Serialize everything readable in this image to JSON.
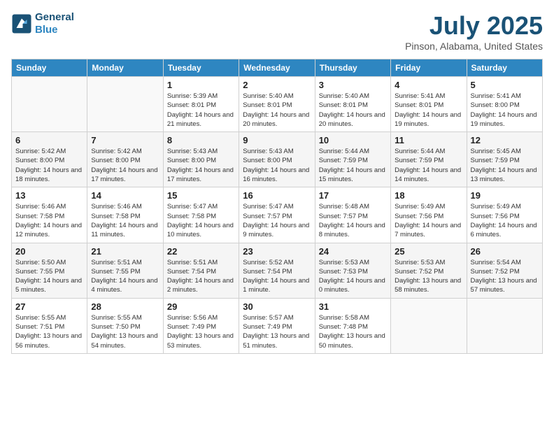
{
  "header": {
    "logo_line1": "General",
    "logo_line2": "Blue",
    "month": "July 2025",
    "location": "Pinson, Alabama, United States"
  },
  "weekdays": [
    "Sunday",
    "Monday",
    "Tuesday",
    "Wednesday",
    "Thursday",
    "Friday",
    "Saturday"
  ],
  "weeks": [
    [
      {
        "day": "",
        "info": ""
      },
      {
        "day": "",
        "info": ""
      },
      {
        "day": "1",
        "info": "Sunrise: 5:39 AM\nSunset: 8:01 PM\nDaylight: 14 hours and 21 minutes."
      },
      {
        "day": "2",
        "info": "Sunrise: 5:40 AM\nSunset: 8:01 PM\nDaylight: 14 hours and 20 minutes."
      },
      {
        "day": "3",
        "info": "Sunrise: 5:40 AM\nSunset: 8:01 PM\nDaylight: 14 hours and 20 minutes."
      },
      {
        "day": "4",
        "info": "Sunrise: 5:41 AM\nSunset: 8:01 PM\nDaylight: 14 hours and 19 minutes."
      },
      {
        "day": "5",
        "info": "Sunrise: 5:41 AM\nSunset: 8:00 PM\nDaylight: 14 hours and 19 minutes."
      }
    ],
    [
      {
        "day": "6",
        "info": "Sunrise: 5:42 AM\nSunset: 8:00 PM\nDaylight: 14 hours and 18 minutes."
      },
      {
        "day": "7",
        "info": "Sunrise: 5:42 AM\nSunset: 8:00 PM\nDaylight: 14 hours and 17 minutes."
      },
      {
        "day": "8",
        "info": "Sunrise: 5:43 AM\nSunset: 8:00 PM\nDaylight: 14 hours and 17 minutes."
      },
      {
        "day": "9",
        "info": "Sunrise: 5:43 AM\nSunset: 8:00 PM\nDaylight: 14 hours and 16 minutes."
      },
      {
        "day": "10",
        "info": "Sunrise: 5:44 AM\nSunset: 7:59 PM\nDaylight: 14 hours and 15 minutes."
      },
      {
        "day": "11",
        "info": "Sunrise: 5:44 AM\nSunset: 7:59 PM\nDaylight: 14 hours and 14 minutes."
      },
      {
        "day": "12",
        "info": "Sunrise: 5:45 AM\nSunset: 7:59 PM\nDaylight: 14 hours and 13 minutes."
      }
    ],
    [
      {
        "day": "13",
        "info": "Sunrise: 5:46 AM\nSunset: 7:58 PM\nDaylight: 14 hours and 12 minutes."
      },
      {
        "day": "14",
        "info": "Sunrise: 5:46 AM\nSunset: 7:58 PM\nDaylight: 14 hours and 11 minutes."
      },
      {
        "day": "15",
        "info": "Sunrise: 5:47 AM\nSunset: 7:58 PM\nDaylight: 14 hours and 10 minutes."
      },
      {
        "day": "16",
        "info": "Sunrise: 5:47 AM\nSunset: 7:57 PM\nDaylight: 14 hours and 9 minutes."
      },
      {
        "day": "17",
        "info": "Sunrise: 5:48 AM\nSunset: 7:57 PM\nDaylight: 14 hours and 8 minutes."
      },
      {
        "day": "18",
        "info": "Sunrise: 5:49 AM\nSunset: 7:56 PM\nDaylight: 14 hours and 7 minutes."
      },
      {
        "day": "19",
        "info": "Sunrise: 5:49 AM\nSunset: 7:56 PM\nDaylight: 14 hours and 6 minutes."
      }
    ],
    [
      {
        "day": "20",
        "info": "Sunrise: 5:50 AM\nSunset: 7:55 PM\nDaylight: 14 hours and 5 minutes."
      },
      {
        "day": "21",
        "info": "Sunrise: 5:51 AM\nSunset: 7:55 PM\nDaylight: 14 hours and 4 minutes."
      },
      {
        "day": "22",
        "info": "Sunrise: 5:51 AM\nSunset: 7:54 PM\nDaylight: 14 hours and 2 minutes."
      },
      {
        "day": "23",
        "info": "Sunrise: 5:52 AM\nSunset: 7:54 PM\nDaylight: 14 hours and 1 minute."
      },
      {
        "day": "24",
        "info": "Sunrise: 5:53 AM\nSunset: 7:53 PM\nDaylight: 14 hours and 0 minutes."
      },
      {
        "day": "25",
        "info": "Sunrise: 5:53 AM\nSunset: 7:52 PM\nDaylight: 13 hours and 58 minutes."
      },
      {
        "day": "26",
        "info": "Sunrise: 5:54 AM\nSunset: 7:52 PM\nDaylight: 13 hours and 57 minutes."
      }
    ],
    [
      {
        "day": "27",
        "info": "Sunrise: 5:55 AM\nSunset: 7:51 PM\nDaylight: 13 hours and 56 minutes."
      },
      {
        "day": "28",
        "info": "Sunrise: 5:55 AM\nSunset: 7:50 PM\nDaylight: 13 hours and 54 minutes."
      },
      {
        "day": "29",
        "info": "Sunrise: 5:56 AM\nSunset: 7:49 PM\nDaylight: 13 hours and 53 minutes."
      },
      {
        "day": "30",
        "info": "Sunrise: 5:57 AM\nSunset: 7:49 PM\nDaylight: 13 hours and 51 minutes."
      },
      {
        "day": "31",
        "info": "Sunrise: 5:58 AM\nSunset: 7:48 PM\nDaylight: 13 hours and 50 minutes."
      },
      {
        "day": "",
        "info": ""
      },
      {
        "day": "",
        "info": ""
      }
    ]
  ]
}
